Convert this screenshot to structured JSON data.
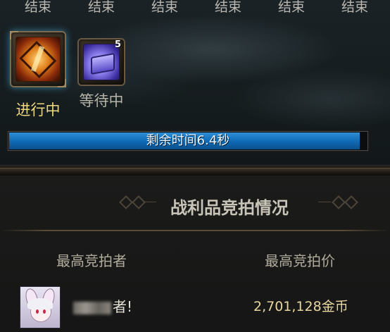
{
  "status_row": {
    "labels": [
      "结束",
      "结束",
      "结束",
      "结束",
      "结束",
      "结束"
    ]
  },
  "loot_slots": [
    {
      "icon": "treasure-chest-icon",
      "label": "进行中",
      "count": null
    },
    {
      "icon": "box-icon",
      "label": "等待中",
      "count": "5"
    }
  ],
  "timer": {
    "text": "剩余时间6.4秒",
    "progress": 0.98
  },
  "auction": {
    "title": "战利品竞拍情况",
    "bidder_header": "最高竞拍者",
    "price_header": "最高竞拍价",
    "top_bid": {
      "bidder_name_visible": "者!",
      "amount": "2,701,128金币"
    }
  },
  "colors": {
    "timer_fill": "#0f6cb8",
    "active_label": "#f0d880",
    "waiting_label": "#b6b3a8",
    "amount_text": "#e8d6a0"
  }
}
